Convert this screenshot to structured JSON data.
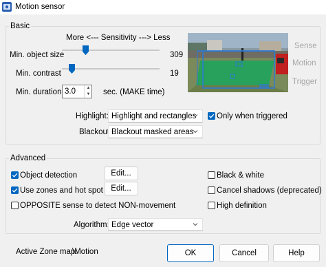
{
  "window": {
    "title": "Motion sensor"
  },
  "basic": {
    "group_label": "Basic",
    "sensitivity_header": "More <--- Sensitivity ---> Less",
    "min_object_size": {
      "label": "Min. object size",
      "value": "309",
      "slider_fraction": 0.24
    },
    "min_contrast": {
      "label": "Min. contrast",
      "value": "19",
      "slider_fraction": 0.1
    },
    "min_duration": {
      "label": "Min. duration",
      "value": "3.0",
      "unit": "sec.  (MAKE time)"
    },
    "highlight": {
      "label": "Highlight:",
      "value": "Highlight and rectangles"
    },
    "only_when_triggered": {
      "label": "Only when triggered",
      "checked": true
    },
    "blackout": {
      "label": "Blackout:",
      "value": "Blackout masked areas"
    },
    "side_labels": {
      "sense": "Sense",
      "motion": "Motion",
      "trigger": "Trigger"
    }
  },
  "advanced": {
    "group_label": "Advanced",
    "object_detection": {
      "label": "Object detection",
      "checked": true,
      "edit_label": "Edit..."
    },
    "use_zones": {
      "label": "Use zones and hot spot",
      "checked": true,
      "edit_label": "Edit..."
    },
    "opposite_sense": {
      "label": "OPPOSITE sense to detect NON-movement",
      "checked": false
    },
    "black_white": {
      "label": "Black & white",
      "checked": false
    },
    "cancel_shadows": {
      "label": "Cancel shadows (deprecated)",
      "checked": false
    },
    "high_definition": {
      "label": "High definition",
      "checked": false
    },
    "algorithm": {
      "label": "Algorithm:",
      "value": "Edge vector"
    }
  },
  "footer": {
    "active_zone_label": "Active Zone map:",
    "active_zone_value": "\\Motion",
    "ok_label": "OK",
    "cancel_label": "Cancel",
    "help_label": "Help"
  },
  "colors": {
    "accent": "#0067c0",
    "zone_fill": "#1fa35c",
    "zone_border": "#2a7ad8",
    "side_label": "#a7a7a7"
  },
  "icons": {
    "app": "app-icon",
    "spin_up": "chevron-up-icon",
    "spin_down": "chevron-down-icon",
    "combo": "chevron-down-icon",
    "check": "checkmark-icon"
  }
}
